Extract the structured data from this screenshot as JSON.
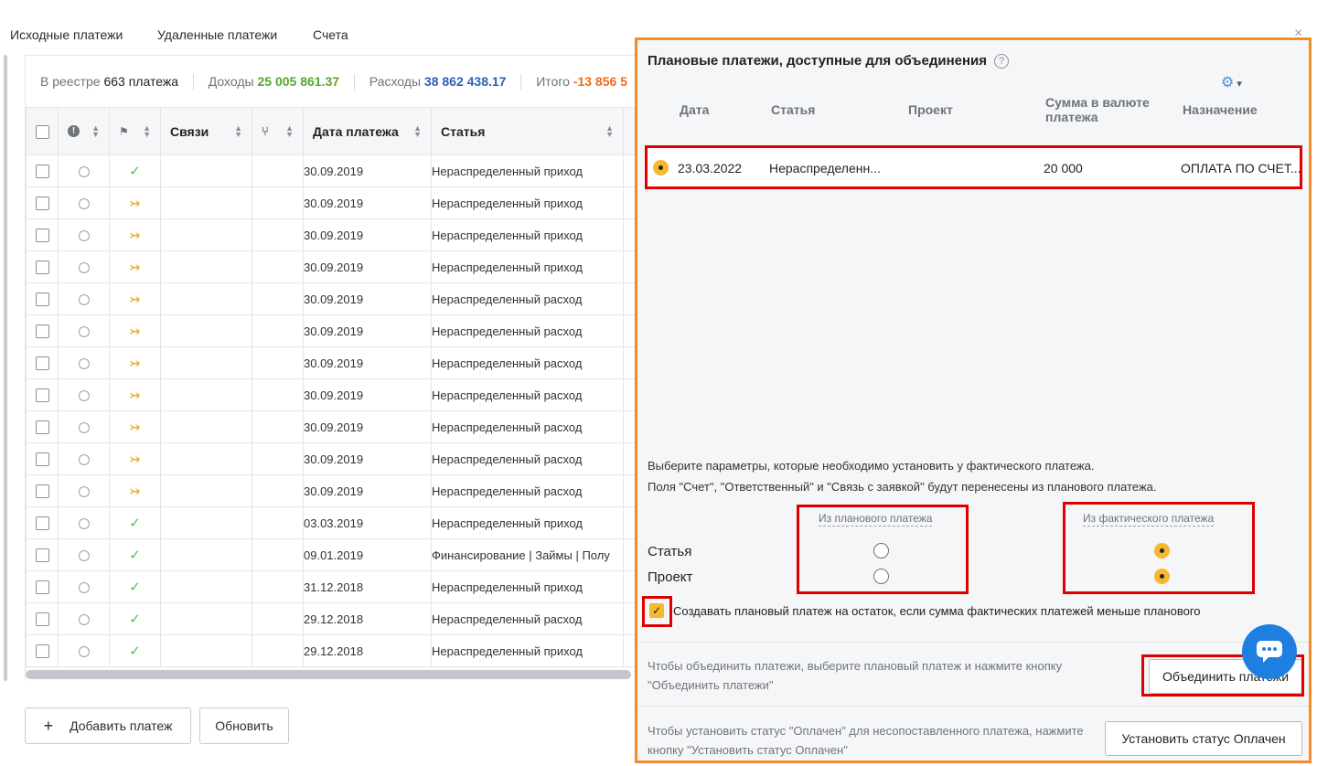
{
  "nav": {
    "tabs": [
      "Исходные платежи",
      "Удаленные платежи",
      "Счета"
    ],
    "close": "×"
  },
  "stats": {
    "registry_label": "В реестре",
    "registry_value": "663 платежа",
    "income_label": "Доходы",
    "income_value": "25 005 861.37",
    "expense_label": "Расходы",
    "expense_value": "38 862 438.17",
    "total_label": "Итого",
    "total_value": "-13 856 5"
  },
  "table": {
    "headers": {
      "links": "Связи",
      "date": "Дата платежа",
      "article": "Статья"
    },
    "rows": [
      {
        "status": "ok",
        "date": "30.09.2019",
        "article": "Нераспределенный приход"
      },
      {
        "status": "split",
        "date": "30.09.2019",
        "article": "Нераспределенный приход"
      },
      {
        "status": "split",
        "date": "30.09.2019",
        "article": "Нераспределенный приход"
      },
      {
        "status": "split",
        "date": "30.09.2019",
        "article": "Нераспределенный приход"
      },
      {
        "status": "split",
        "date": "30.09.2019",
        "article": "Нераспределенный расход"
      },
      {
        "status": "split",
        "date": "30.09.2019",
        "article": "Нераспределенный расход"
      },
      {
        "status": "split",
        "date": "30.09.2019",
        "article": "Нераспределенный расход"
      },
      {
        "status": "split",
        "date": "30.09.2019",
        "article": "Нераспределенный расход"
      },
      {
        "status": "split",
        "date": "30.09.2019",
        "article": "Нераспределенный расход"
      },
      {
        "status": "split",
        "date": "30.09.2019",
        "article": "Нераспределенный расход"
      },
      {
        "status": "split",
        "date": "30.09.2019",
        "article": "Нераспределенный расход"
      },
      {
        "status": "ok",
        "date": "03.03.2019",
        "article": "Нераспределенный приход"
      },
      {
        "status": "ok",
        "date": "09.01.2019",
        "article": "Финансирование | Займы | Полу"
      },
      {
        "status": "ok",
        "date": "31.12.2018",
        "article": "Нераспределенный приход"
      },
      {
        "status": "ok",
        "date": "29.12.2018",
        "article": "Нераспределенный расход"
      },
      {
        "status": "ok",
        "date": "29.12.2018",
        "article": "Нераспределенный приход"
      }
    ]
  },
  "actions": {
    "add": "Добавить платеж",
    "add_icon": "+",
    "refresh": "Обновить"
  },
  "modal": {
    "title": "Плановые платежи, доступные для объединения",
    "help": "?",
    "columns": {
      "date": "Дата",
      "article": "Статья",
      "project": "Проект",
      "amount": "Сумма в валюте платежа",
      "purpose": "Назначение"
    },
    "selected_row": {
      "date": "23.03.2022",
      "article": "Нераспределенн...",
      "amount": "20 000",
      "purpose": "ОПЛАТА ПО СЧЕТ..."
    },
    "info_line1": "Выберите параметры, которые необходимо установить у фактического платежа.",
    "info_line2": "Поля \"Счет\", \"Ответственный\" и \"Связь с заявкой\" будут перенесены из планового платежа.",
    "from_plan": "Из планового платежа",
    "from_fact": "Из фактического платежа",
    "param_article": "Статья",
    "param_project": "Проект",
    "create_remainder": "Создавать плановый платеж на остаток, если сумма фактических платежей меньше планового",
    "merge_hint": "Чтобы объединить платежи, выберите плановый платеж и нажмите кнопку \"Объединить платежи\"",
    "merge_button": "Объединить платежи",
    "paid_hint": "Чтобы установить статус \"Оплачен\" для несопоставленного платежа, нажмите кнопку \"Установить статус Оплачен\"",
    "paid_button": "Установить статус Оплачен"
  },
  "colors": {
    "accent_orange": "#f28c28",
    "highlight_red": "#e00000",
    "income_green": "#55a630",
    "expense_blue": "#2f5fb3",
    "chat_blue": "#1e7fe0"
  },
  "icons": [
    "close-icon",
    "alert-icon",
    "flag-icon",
    "branch-icon",
    "sort-icon",
    "check-icon",
    "split-arrow-icon",
    "help-icon",
    "gear-icon",
    "chat-icon",
    "plus-icon"
  ]
}
